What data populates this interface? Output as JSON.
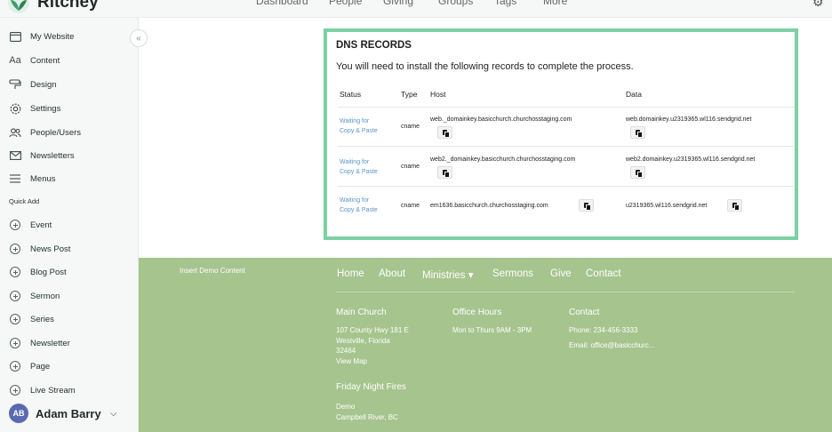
{
  "brand": {
    "name": "Ritchey"
  },
  "top_nav": [
    "Dashboard",
    "People",
    "Giving",
    "Groups",
    "Tags",
    "More"
  ],
  "sidebar": {
    "items": [
      {
        "label": "My Website",
        "icon": "browser-window-icon"
      },
      {
        "label": "Content",
        "icon": "text-aa-icon"
      },
      {
        "label": "Design",
        "icon": "paint-roller-icon"
      },
      {
        "label": "Settings",
        "icon": "settings-icon"
      },
      {
        "label": "People/Users",
        "icon": "users-icon"
      },
      {
        "label": "Newsletters",
        "icon": "mail-icon"
      },
      {
        "label": "Menus",
        "icon": "menu-lines-icon"
      }
    ],
    "quick_add_label": "Quick Add",
    "quick_add": [
      "Event",
      "News Post",
      "Blog Post",
      "Sermon",
      "Series",
      "Newsletter",
      "Page",
      "Live Stream"
    ],
    "user": {
      "initials": "AB",
      "name": "Adam Barry"
    }
  },
  "dns": {
    "title": "DNS RECORDS",
    "subtitle": "You will need to install the following records to complete the process.",
    "headers": {
      "status": "Status",
      "type": "Type",
      "host": "Host",
      "data": "Data"
    },
    "rows": [
      {
        "status_line1": "Waiting for",
        "status_line2": "Copy & Paste",
        "type": "cname",
        "host": "web._domainkey.basicchurch.churchosstaging.com",
        "data": "web.domainkey.u2319365.wl116.sendgrid.net"
      },
      {
        "status_line1": "Waiting for",
        "status_line2": "Copy & Paste",
        "type": "cname",
        "host": "web2._domainkey.basicchurch.churchosstaging.com",
        "data": "web2.domainkey.u2319365.wl116.sendgrid.net"
      },
      {
        "status_line1": "Waiting for",
        "status_line2": "Copy & Paste",
        "type": "cname",
        "host": "em1636.basicchurch.churchosstaging.com",
        "data": "u2319365.wl116.sendgrid.net"
      }
    ]
  },
  "footer": {
    "demo_label": "Insert Demo Content",
    "nav": [
      "Home",
      "About",
      "Ministries ▾",
      "Sermons",
      "Give",
      "Contact"
    ],
    "main_church": {
      "heading": "Main Church",
      "line1": "107 County Hwy 181 E",
      "line2": "Westville, Florida",
      "line3": "32464",
      "line4": "View Map"
    },
    "office_hours": {
      "heading": "Office Hours",
      "line1": "Mon to Thurs 9AM - 3PM"
    },
    "contact": {
      "heading": "Contact",
      "phone": "Phone: 234-456-3333",
      "email": "Email:  office@basicchurc..."
    },
    "friday": {
      "heading": "Friday Night Fires",
      "line1": "Demo",
      "line2": "Campbell River, BC"
    }
  },
  "colors": {
    "accent_border": "#7bd1a3",
    "status_link": "#5b95c9",
    "footer_bg": "#a6c48e",
    "sidebar_bg": "#f6f8f7"
  }
}
